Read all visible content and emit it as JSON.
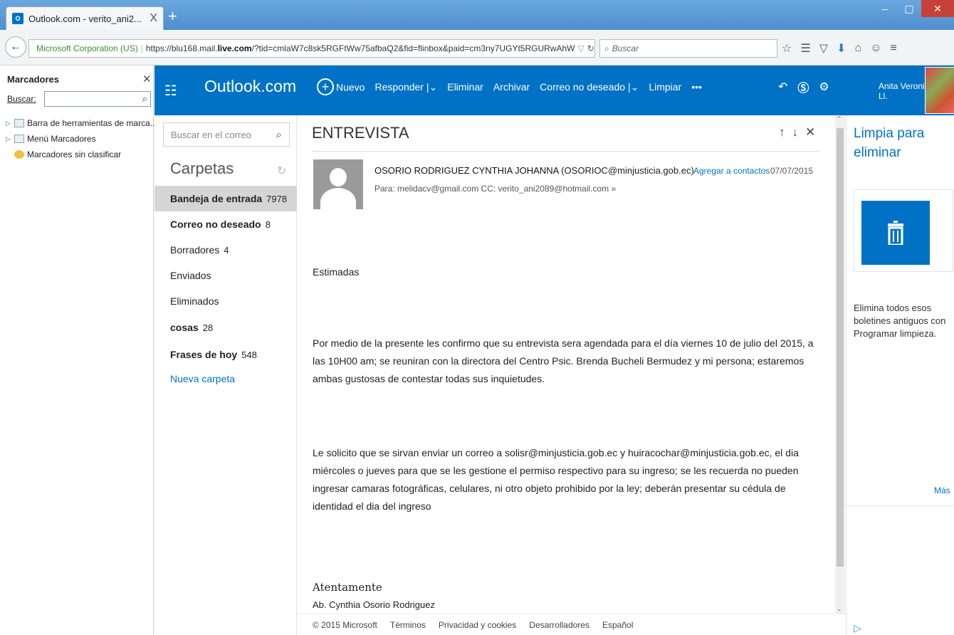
{
  "browser": {
    "tab_title": "Outlook.com - verito_ani2...",
    "tab_close": "X",
    "new_tab": "+",
    "window_controls": [
      "–",
      "▢",
      "✕"
    ],
    "url_security_name": "Microsoft Corporation (US)",
    "url_prefix": "https://blu168.mail.",
    "url_host": "live.com",
    "url_rest": "/?tid=cmlaW7c8sk5RGFtWw75afbaQ2&fid=flinbox&paid=cm3ny7UGYt5RGURwAhW",
    "search_placeholder": "Buscar"
  },
  "bookmarks": {
    "title": "Marcadores",
    "search_label": "Buscar:",
    "items": [
      {
        "label": "Barra de herramientas de marca..."
      },
      {
        "label": "Menú Marcadores"
      },
      {
        "label": "Marcadores sin clasificar"
      }
    ]
  },
  "outlook": {
    "app_title": "Outlook.com",
    "commands": {
      "new": "Nuevo",
      "reply": "Responder",
      "delete": "Eliminar",
      "archive": "Archivar",
      "junk": "Correo no deseado",
      "sweep": "Limpiar",
      "more": "•••"
    },
    "user_name": "Anita Veronica C. Ll."
  },
  "folders": {
    "search_placeholder": "Buscar en el correo",
    "heading": "Carpetas",
    "items": [
      {
        "name": "Bandeja de entrada",
        "count": "7978"
      },
      {
        "name": "Correo no deseado",
        "count": "8"
      },
      {
        "name": "Borradores",
        "count": "4"
      },
      {
        "name": "Enviados",
        "count": ""
      },
      {
        "name": "Eliminados",
        "count": ""
      },
      {
        "name": "cosas",
        "count": "28"
      },
      {
        "name": "Frases de hoy",
        "count": "548"
      }
    ],
    "new_folder": "Nueva carpeta"
  },
  "message": {
    "subject": "ENTREVISTA",
    "sender_name": "OSORIO RODRIGUEZ CYNTHIA JOHANNA",
    "sender_email": "(OSORIOC@minjusticia.gob.ec)",
    "add_contact": "Agregar a contactos",
    "date": "07/07/2015",
    "recipients": "Para: melidacv@gmail.com CC: verito_ani2089@hotmail.com",
    "greeting": "Estimadas",
    "para1": "Por medio de la presente les confirmo que su entrevista sera agendada para el día viernes 10 de julio del 2015, a las 10H00 am; se reuniran con la directora del Centro Psic. Brenda Bucheli Bermudez y mi persona; estaremos ambas gustosas de contestar todas sus inquietudes.",
    "para2": "Le solicito que se sirvan enviar un correo a solisr@minjusticia.gob.ec y huiracochar@minjusticia.gob.ec, el dia miércoles o jueves para que se les gestione el permiso respectivo para su ingreso; se les recuerda no pueden ingresar camaras fotográficas, celulares, ni otro objeto prohibido por la ley; deberán presentar su cédula de identidad el dia del ingreso",
    "signoff": "Atentamente",
    "signature": "Ab. Cynthia Osorio Rodriguez"
  },
  "footer": {
    "copyright": "© 2015 Microsoft",
    "terms": "Términos",
    "privacy": "Privacidad y cookies",
    "developers": "Desarrolladores",
    "language": "Español"
  },
  "ad": {
    "title": "Limpia para eliminar",
    "description": "Elimina todos esos boletines antiguos con Programar limpieza.",
    "more": "Más"
  },
  "colors": {
    "outlook_blue": "#0072c6",
    "selected_folder": "#d5d5d5"
  }
}
